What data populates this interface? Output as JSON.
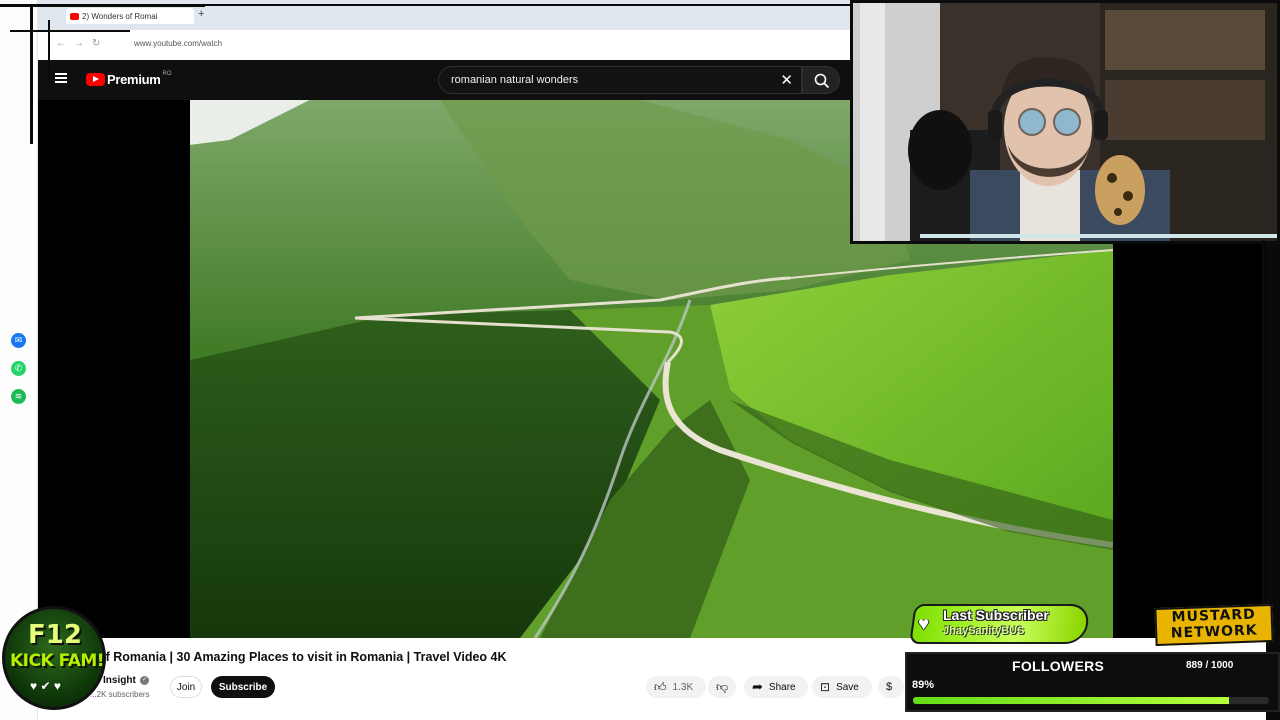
{
  "browser": {
    "tab_title": "2) Wonders of Romai",
    "new_tab": "+",
    "url": "www.youtube.com/watch"
  },
  "sidebar_icons": [
    "messenger-icon",
    "whatsapp-icon",
    "spotify-icon"
  ],
  "youtube": {
    "brand": "Premium",
    "country_code": "RO",
    "search_value": "romanian natural wonders",
    "video": {
      "title": "of Romania | 30 Amazing Places to visit in Romania | Travel Video 4K",
      "channel": "Insight",
      "subscribers": "...2K subscribers",
      "join_label": "Join",
      "subscribe_label": "Subscribe",
      "likes": "1.3K",
      "share_label": "Share",
      "save_label": "Save"
    }
  },
  "overlay": {
    "last_subscriber_title": "Last Subscriber",
    "last_subscriber_name": "JhaySanityBUS",
    "followers_title": "FOLLOWERS",
    "followers_count": "889 / 1000",
    "followers_percent_label": "89%",
    "followers_progress": 0.889,
    "network_line1": "MUSTARD",
    "network_line2": "NETWORK",
    "badge_line1": "F12",
    "badge_line2": "KICK FAM!",
    "badge_icons": "♥ ✔ ♥"
  },
  "colors": {
    "accent_green": "#7ee000",
    "youtube_red": "#ff0000",
    "mustard": "#e8b400"
  }
}
